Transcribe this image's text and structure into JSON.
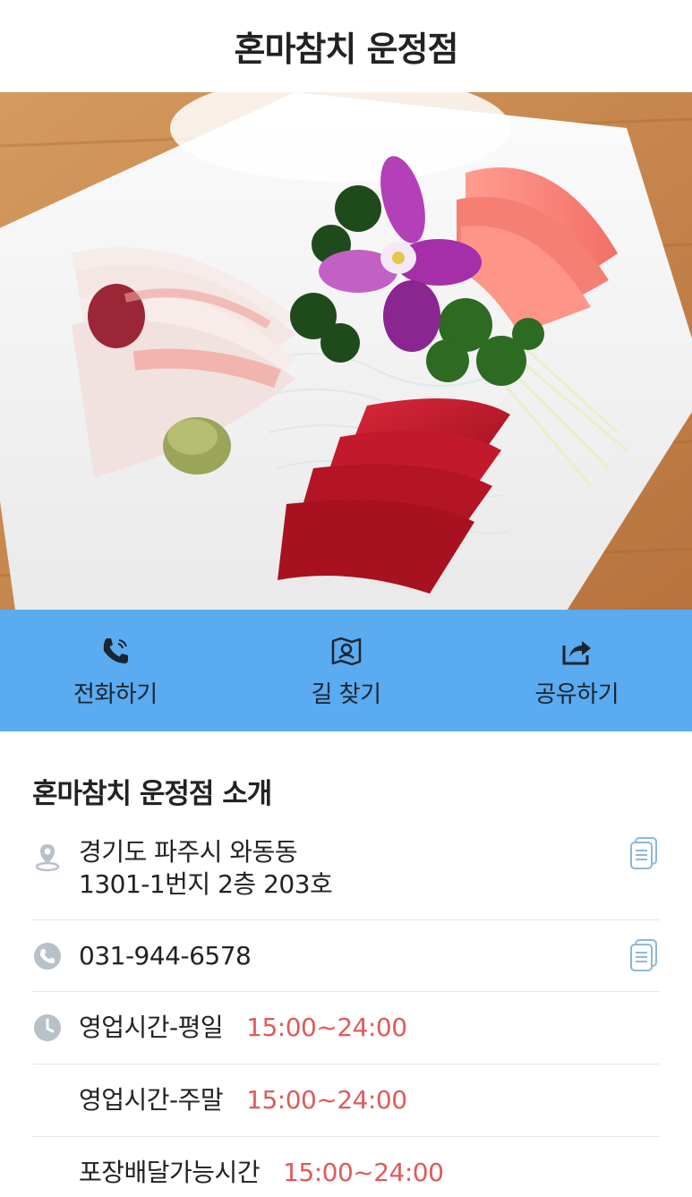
{
  "header": {
    "title": "혼마참치 운정점"
  },
  "hero": {
    "image_icon": "sashimi-platter-photo"
  },
  "actions": [
    {
      "label": "전화하기",
      "icon": "phone-icon"
    },
    {
      "label": "길 찾기",
      "icon": "map-icon"
    },
    {
      "label": "공유하기",
      "icon": "share-icon"
    }
  ],
  "info": {
    "title": "혼마참치 운정점 소개",
    "address_line1": "경기도 파주시 와동동",
    "address_line2": "1301-1번지 2층 203호",
    "phone": "031-944-6578",
    "hours": [
      {
        "label": "영업시간-평일",
        "time": "15:00~24:00"
      },
      {
        "label": "영업시간-주말",
        "time": "15:00~24:00"
      },
      {
        "label": "포장배달가능시간",
        "time": "15:00~24:00"
      }
    ]
  },
  "colors": {
    "accent_bar": "#5aabf0",
    "time_text": "#e05a5a",
    "icon_grey": "#b8c0c8",
    "copy_icon": "#8fb8d8"
  }
}
